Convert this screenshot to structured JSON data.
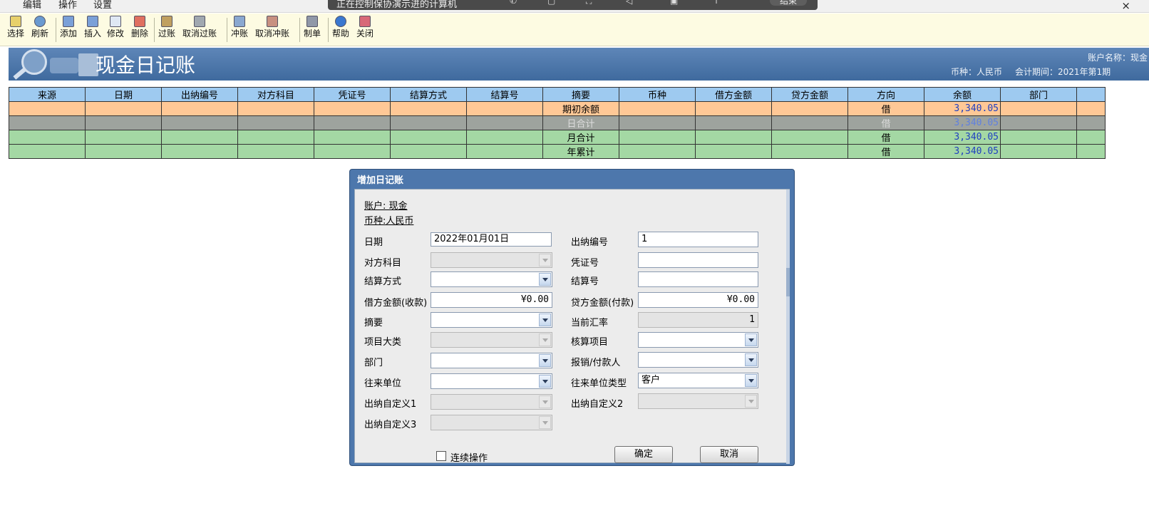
{
  "menu": {
    "items": [
      "编辑",
      "操作",
      "设置"
    ],
    "close": "×"
  },
  "overlay": {
    "text": "正在控制保协演示进的计算机",
    "end_label": "结束"
  },
  "toolbar": {
    "items": [
      "选择",
      "刷新",
      "添加",
      "插入",
      "修改",
      "删除",
      "过账",
      "取消过账",
      "冲账",
      "取消冲账",
      "制单",
      "帮助",
      "关闭"
    ]
  },
  "header": {
    "title": "现金日记账",
    "account_name": "账户名称：现金",
    "currency": "币种：人民币",
    "period": "会计期间：2021年第1期"
  },
  "table": {
    "columns": [
      "来源",
      "日期",
      "出纳编号",
      "对方科目",
      "凭证号",
      "结算方式",
      "结算号",
      "摘要",
      "币种",
      "借方金额",
      "贷方金额",
      "方向",
      "余额",
      "部门"
    ],
    "rows": [
      {
        "summary": "期初余额",
        "direction": "借",
        "balance": "3,340.05"
      },
      {
        "summary": "日合计",
        "direction": "借",
        "balance": "3,340.05"
      },
      {
        "summary": "月合计",
        "direction": "借",
        "balance": "3,340.05"
      },
      {
        "summary": "年累计",
        "direction": "借",
        "balance": "3,340.05"
      }
    ]
  },
  "dialog": {
    "title": "增加日记账",
    "account": "账户: 现金",
    "currency": "币种:人民币",
    "labels": {
      "date": "日期",
      "cashier_no": "出纳编号",
      "counter_subject": "对方科目",
      "voucher_no": "凭证号",
      "settle_method": "结算方式",
      "settle_no": "结算号",
      "debit": "借方金额(收款)",
      "credit": "贷方金额(付款)",
      "summary": "摘要",
      "rate": "当前汇率",
      "project_class": "项目大类",
      "acct_project": "核算项目",
      "dept": "部门",
      "payee": "报销/付款人",
      "partner": "往来单位",
      "partner_type": "往来单位类型",
      "custom1": "出纳自定义1",
      "custom2": "出纳自定义2",
      "custom3": "出纳自定义3"
    },
    "values": {
      "date": "2022年01月01日",
      "cashier_no": "1",
      "debit": "¥0.00",
      "credit": "¥0.00",
      "rate": "1",
      "partner_type": "客户"
    },
    "continuous": "连续操作",
    "ok": "确定",
    "cancel": "取消"
  }
}
